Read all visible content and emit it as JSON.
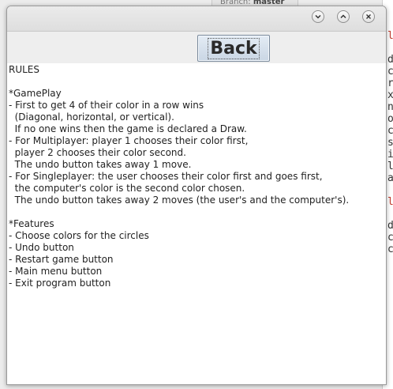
{
  "background": {
    "branch_label": "Branch:",
    "branch_name": "master",
    "code_lines": [
      {
        "text": "l",
        "red": true
      },
      {
        "text": "",
        "red": false
      },
      {
        "text": "d",
        "red": false
      },
      {
        "text": "c",
        "red": false
      },
      {
        "text": "r",
        "red": false
      },
      {
        "text": "x",
        "red": false
      },
      {
        "text": "n",
        "red": false
      },
      {
        "text": "o",
        "red": false
      },
      {
        "text": "c",
        "red": false
      },
      {
        "text": "s",
        "red": false
      },
      {
        "text": "i",
        "red": false
      },
      {
        "text": "l",
        "red": false
      },
      {
        "text": "a",
        "red": false
      },
      {
        "text": "",
        "red": false
      },
      {
        "text": "l",
        "red": true
      },
      {
        "text": "",
        "red": false
      },
      {
        "text": "d",
        "red": false
      },
      {
        "text": "c",
        "red": false
      },
      {
        "text": "c",
        "red": false
      }
    ]
  },
  "window": {
    "controls": {
      "minimize_icon": "chevron-down",
      "maximize_icon": "chevron-up",
      "close_icon": "close-x"
    },
    "back_button_label": "Back",
    "rules_lines": [
      "RULES",
      "",
      "*GamePlay",
      "- First to get 4 of their color in a row wins",
      "  (Diagonal, horizontal, or vertical).",
      "  If no one wins then the game is declared a Draw.",
      "- For Multiplayer: player 1 chooses their color first,",
      "  player 2 chooses their color second.",
      "  The undo button takes away 1 move.",
      "- For Singleplayer: the user chooses their color first and goes first,",
      "  the computer's color is the second color chosen.",
      "  The undo button takes away 2 moves (the user's and the computer's).",
      "",
      "*Features",
      "- Choose colors for the circles",
      "- Undo button",
      "- Restart game button",
      "- Main menu button",
      "- Exit program button"
    ]
  }
}
